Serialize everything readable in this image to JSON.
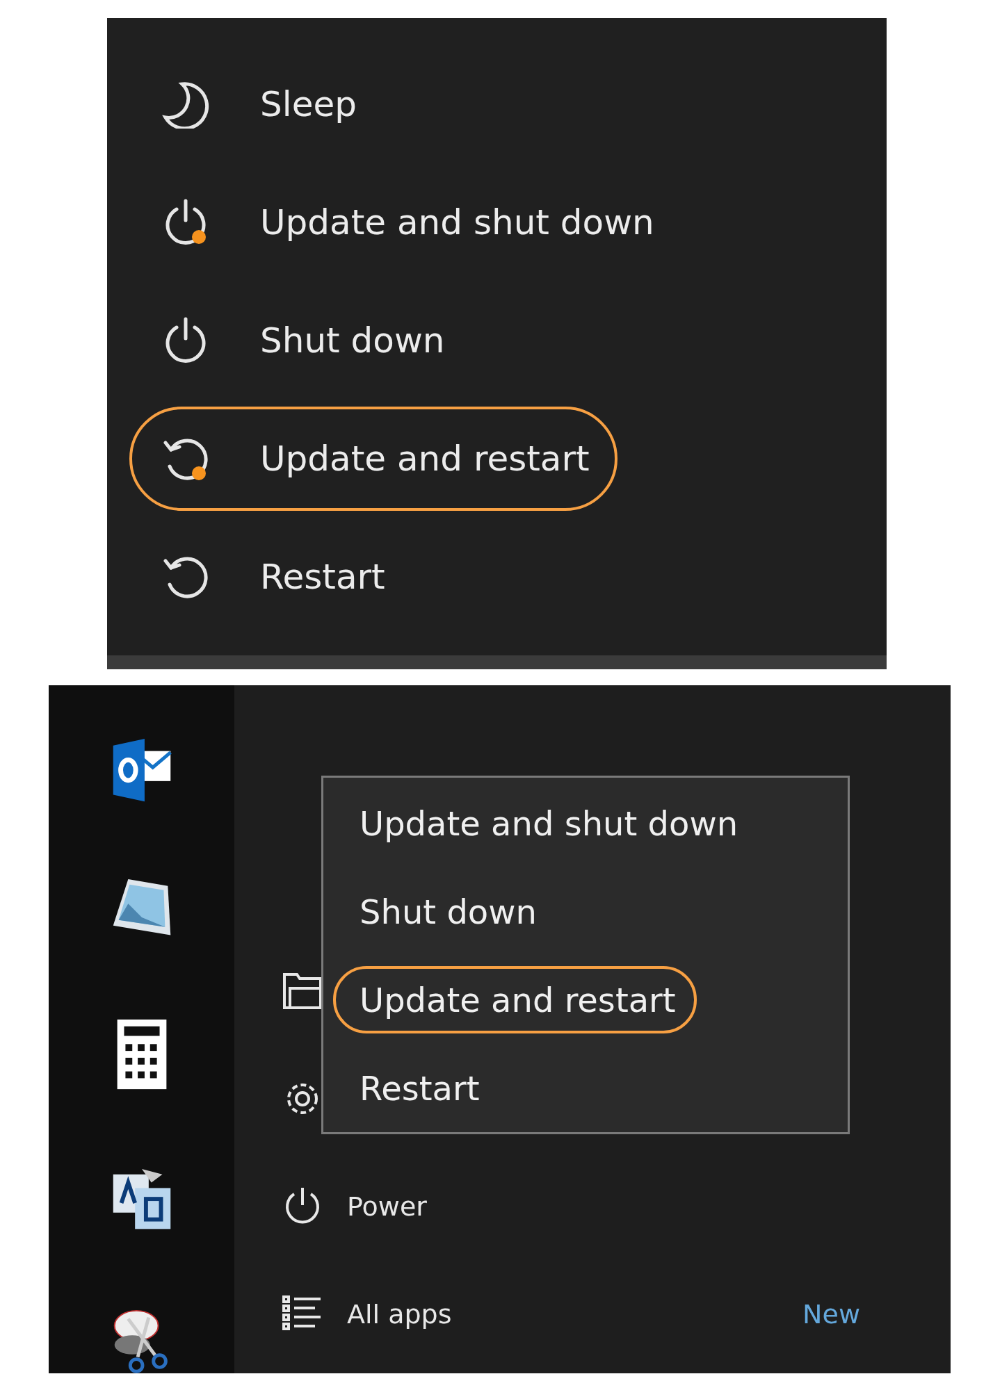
{
  "power_menu": {
    "items": [
      {
        "label": "Sleep",
        "kind": "sleep",
        "highlighted": false
      },
      {
        "label": "Update and shut down",
        "kind": "update-shutdown",
        "highlighted": false
      },
      {
        "label": "Shut down",
        "kind": "shutdown",
        "highlighted": false
      },
      {
        "label": "Update and restart",
        "kind": "update-restart",
        "highlighted": true
      },
      {
        "label": "Restart",
        "kind": "restart",
        "highlighted": false
      }
    ]
  },
  "start_menu": {
    "pinned_apps": [
      {
        "kind": "mail"
      },
      {
        "kind": "picture-viewer"
      },
      {
        "kind": "calculator"
      },
      {
        "kind": "translator"
      },
      {
        "kind": "snipping"
      }
    ],
    "rows": [
      {
        "kind": "folder"
      },
      {
        "kind": "settings"
      },
      {
        "kind": "power",
        "label": "Power"
      },
      {
        "kind": "all-apps",
        "label": "All apps",
        "badge": "New"
      }
    ],
    "power_popup": {
      "items": [
        {
          "label": "Update and shut down",
          "highlighted": false
        },
        {
          "label": "Shut down",
          "highlighted": false
        },
        {
          "label": "Update and restart",
          "highlighted": true
        },
        {
          "label": "Restart",
          "highlighted": false
        }
      ]
    }
  }
}
